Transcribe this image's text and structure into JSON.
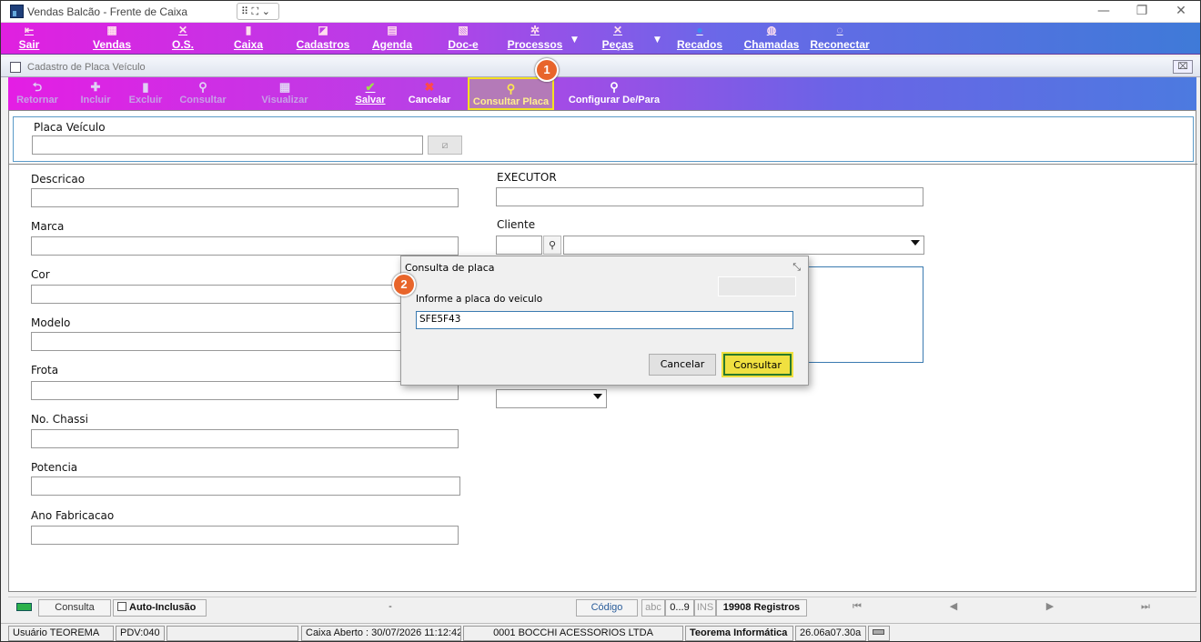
{
  "window": {
    "title": "Vendas Balcão - Frente de Caixa",
    "extra": "⠿ ⛶ ⌄"
  },
  "main_menu": {
    "items": [
      {
        "label": "Sair",
        "icon": "logout-icon",
        "glyph": "⇤"
      },
      {
        "label": "Vendas",
        "icon": "sales-icon",
        "glyph": "▦"
      },
      {
        "label": "O.S.",
        "icon": "tools-icon",
        "glyph": "✕"
      },
      {
        "label": "Caixa",
        "icon": "cashier-icon",
        "glyph": "▮"
      },
      {
        "label": "Cadastros",
        "icon": "register-icon",
        "glyph": "◪"
      },
      {
        "label": "Agenda",
        "icon": "calendar-icon",
        "glyph": "▤"
      },
      {
        "label": "Doc-e",
        "icon": "document-icon",
        "glyph": "▧"
      },
      {
        "label": "Processos",
        "icon": "gear-icon",
        "glyph": "✲"
      },
      {
        "label": "Peças",
        "icon": "parts-icon",
        "glyph": "✕"
      },
      {
        "label": "Recados",
        "icon": "message-icon",
        "glyph": "●"
      },
      {
        "label": "Chamadas",
        "icon": "phone-icon",
        "glyph": "◍"
      },
      {
        "label": "Reconectar",
        "icon": "reconnect-icon",
        "glyph": "◌"
      }
    ]
  },
  "child_window": {
    "title": "Cadastro de Placa Veículo",
    "close": "⌧"
  },
  "toolbar": {
    "items": [
      {
        "label": "Retornar",
        "icon": "return-icon",
        "glyph": "⮌"
      },
      {
        "label": "Incluir",
        "icon": "add-icon",
        "glyph": "✚"
      },
      {
        "label": "Excluir",
        "icon": "delete-icon",
        "glyph": "▮"
      },
      {
        "label": "Consultar",
        "icon": "search-icon",
        "glyph": "⚲"
      },
      {
        "label": "Visualizar",
        "icon": "view-icon",
        "glyph": "▦"
      },
      {
        "label": "Salvar",
        "icon": "check-icon",
        "glyph": "✔"
      },
      {
        "label": "Cancelar",
        "icon": "cancel-icon",
        "glyph": "✖"
      },
      {
        "label": "Consultar Placa",
        "icon": "search-plate-icon",
        "glyph": "⚲"
      },
      {
        "label": "Configurar De/Para",
        "icon": "configure-icon",
        "glyph": "⚲"
      }
    ]
  },
  "badges": {
    "one": "1",
    "two": "2"
  },
  "form": {
    "placa_label": "Placa Veículo",
    "descricao": "Descricao",
    "marca": "Marca",
    "cor": "Cor",
    "modelo": "Modelo",
    "frota": "Frota",
    "chassi": "No. Chassi",
    "potencia": "Potencia",
    "ano": "Ano Fabricacao",
    "executor": "EXECUTOR",
    "cliente": "Cliente"
  },
  "dialog": {
    "title": "Consulta de placa",
    "prompt": "Informe a placa do veiculo",
    "value": "SFE5F43",
    "cancel": "Cancelar",
    "submit": "Consultar"
  },
  "status_bar": {
    "mode": "Consulta",
    "auto_inclusao": "Auto-Inclusão",
    "dash": "-",
    "codigo": "Código",
    "abc": "abc",
    "range": "0...9",
    "ins": "INS",
    "registros": "19908 Registros",
    "nav": [
      "⏮",
      "◀",
      "▶",
      "⏭"
    ]
  },
  "footer": {
    "usuario": "Usuário TEOREMA",
    "pdv": "PDV:040",
    "caixa": "Caixa Aberto : 30/07/2026 11:12:42",
    "empresa": "0001 BOCCHI ACESSORIOS LTDA",
    "teorema": "Teorema Informática",
    "versao": "26.06a07.30a"
  }
}
